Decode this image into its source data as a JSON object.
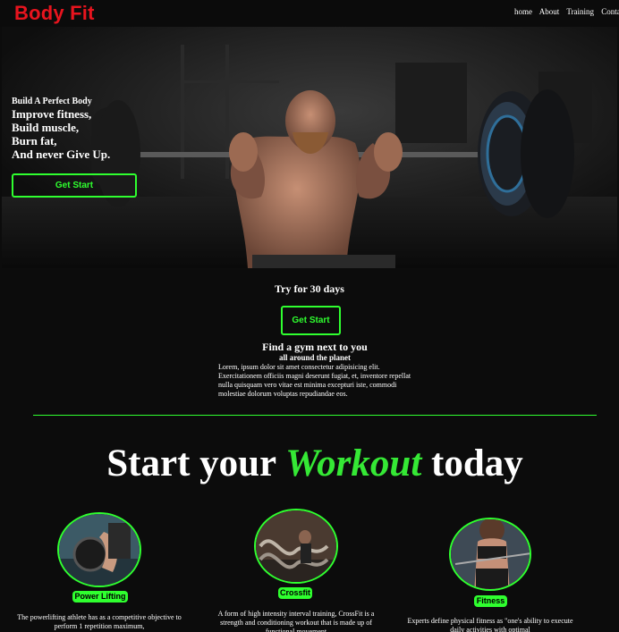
{
  "nav": {
    "logo": "Body Fit",
    "links": [
      "home",
      "About",
      "Training",
      "Contac"
    ]
  },
  "hero": {
    "small": "Build A Perfect Body",
    "lines": [
      "Improve fitness,",
      "Build muscle,",
      "Burn fat,",
      "And never Give Up."
    ],
    "button": "Get Start"
  },
  "try": {
    "title": "Try for 30 days",
    "button": "Get Start"
  },
  "gym": {
    "title": "Find a gym next to you",
    "subtitle": "all around the planet",
    "body": "Lorem, ipsum dolor sit amet consectetur adipisicing elit. Exercitationem officiis magni deserunt fugiat, et, inventore repellat nulla quisquam vero vitae est minima excepturi iste, commodi molestiae dolorum voluptas repudiandae eos."
  },
  "workout": {
    "pre": "Start your",
    "accent": "Workout",
    "post": "today"
  },
  "cards": [
    {
      "label": "Power Lifting",
      "text": "The powerlifting athlete has as a competitive objective to perform 1 repetition maximum,"
    },
    {
      "label": "Crossfit",
      "text": "A form of high intensity interval training, CrossFit is a strength and conditioning workout that is made up of functional movement"
    },
    {
      "label": "Fitness",
      "text": "Experts define physical fitness as \"one's ability to execute daily activities with optimal"
    }
  ],
  "colors": {
    "accent": "#2fff2f",
    "logo": "#e8141e",
    "background": "#0c0c0c"
  }
}
